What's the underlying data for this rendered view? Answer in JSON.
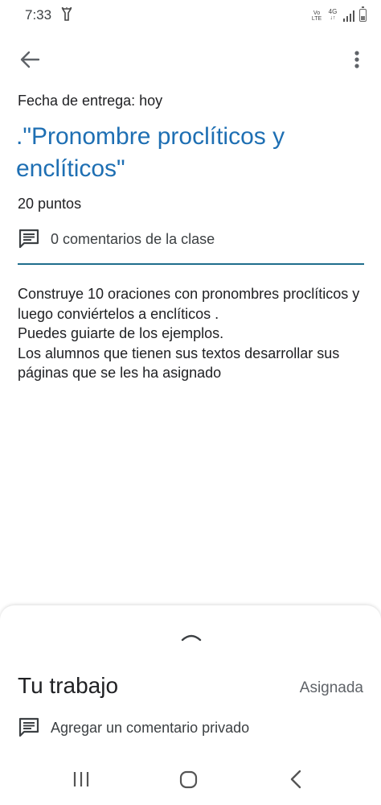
{
  "status_bar": {
    "time": "7:33",
    "volte_label": "Vo\nLTE",
    "network_label": "4G",
    "battery_level": 0.35
  },
  "assignment": {
    "due_date": "Fecha de entrega: hoy",
    "title": ".\"Pronombre proclíticos y enclíticos\"",
    "points": "20 puntos",
    "class_comments": "0 comentarios de la clase",
    "description": "Construye 10 oraciones con pronombres proclíticos y luego conviértelos a enclíticos .\nPuedes guiarte de los ejemplos.\nLos alumnos que tienen sus textos desarrollar sus páginas que se les ha asignado"
  },
  "your_work": {
    "title": "Tu trabajo",
    "status": "Asignada",
    "private_comment": "Agregar un comentario privado"
  },
  "colors": {
    "title_blue": "#1e6fb3",
    "divider": "#1f6e8c"
  },
  "icons": {
    "back": "arrow-left-icon",
    "overflow": "more-vertical-icon",
    "comment": "comment-icon",
    "sheet_handle": "chevron-up-icon",
    "nav_recents": "recents-icon",
    "nav_home": "home-icon",
    "nav_back": "chevron-left-icon"
  }
}
